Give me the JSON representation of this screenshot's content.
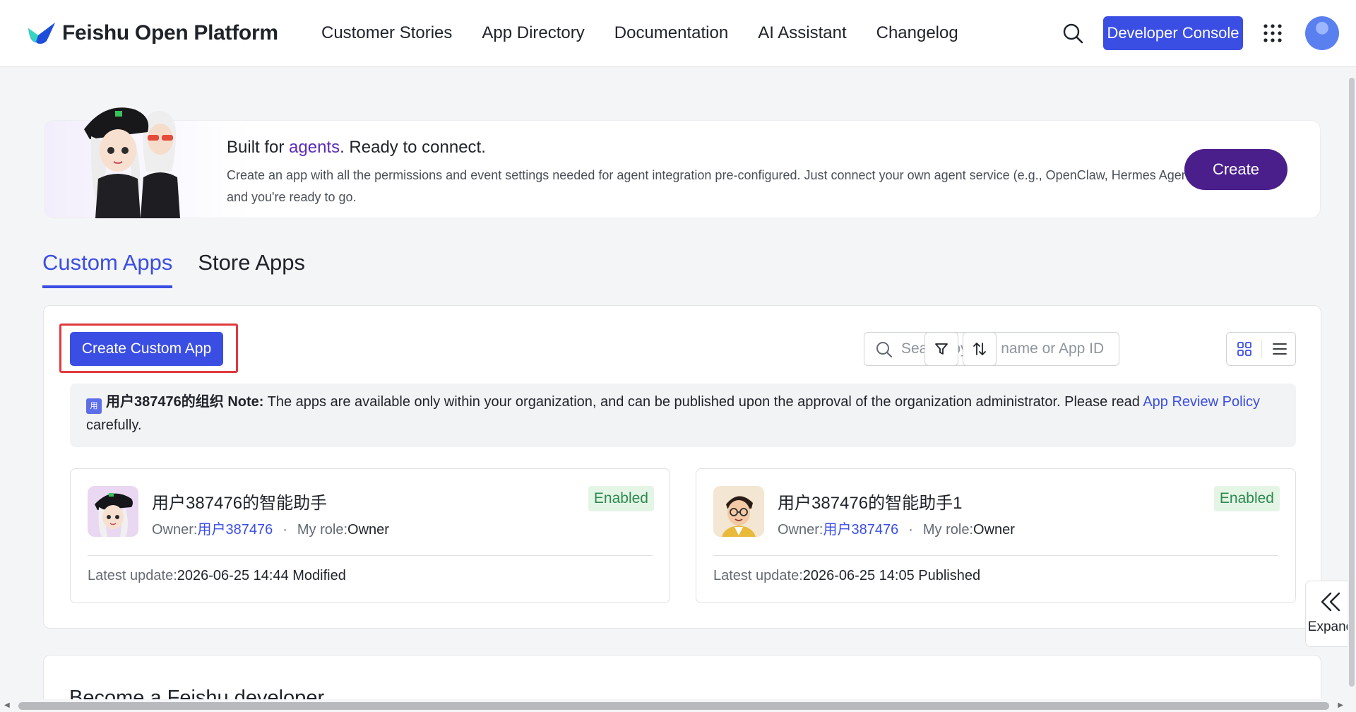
{
  "header": {
    "logo_text": "Feishu Open Platform",
    "nav": [
      {
        "label": "Customer Stories"
      },
      {
        "label": "App Directory"
      },
      {
        "label": "Documentation"
      },
      {
        "label": "AI Assistant"
      },
      {
        "label": "Changelog"
      }
    ],
    "developer_console_label": "Developer Console"
  },
  "banner": {
    "title_before": "Built for ",
    "title_highlight": "agents",
    "title_after": ". Ready to connect.",
    "description": "Create an app with all the permissions and event settings needed for agent integration pre-configured. Just connect your own agent service (e.g., OpenClaw, Hermes Agent) and you're ready to go.",
    "create_label": "Create"
  },
  "tabs": [
    {
      "label": "Custom Apps",
      "active": true
    },
    {
      "label": "Store Apps",
      "active": false
    }
  ],
  "toolbar": {
    "create_button_label": "Create Custom App",
    "search_placeholder": "Search by app name or App ID"
  },
  "notice": {
    "org_icon_text": "用",
    "org_name": "用户387476的组织",
    "note_label": "Note:",
    "text": " The apps are available only within your organization, and can be published upon the approval of the organization administrator. Please read ",
    "link_text": "App Review Policy",
    "suffix": " carefully."
  },
  "apps": [
    {
      "name": "用户387476的智能助手",
      "status": "Enabled",
      "owner_label": "Owner:",
      "owner": "用户387476",
      "role_label": "My role:",
      "role": "Owner",
      "update_label": "Latest update:",
      "update_value": "2026-06-25 14:44 Modified"
    },
    {
      "name": "用户387476的智能助手1",
      "status": "Enabled",
      "owner_label": "Owner:",
      "owner": "用户387476",
      "role_label": "My role:",
      "role": "Owner",
      "update_label": "Latest update:",
      "update_value": "2026-06-25 14:05 Published"
    }
  ],
  "lower_card": {
    "title": "Become a Feishu developer"
  },
  "expand_label": "Expand",
  "colors": {
    "primary": "#3b4ee3",
    "banner_button": "#4a1f8c",
    "enabled_bg": "#e4f5e6",
    "enabled_text": "#2e8a4f",
    "highlight_outline": "#e0393e"
  }
}
